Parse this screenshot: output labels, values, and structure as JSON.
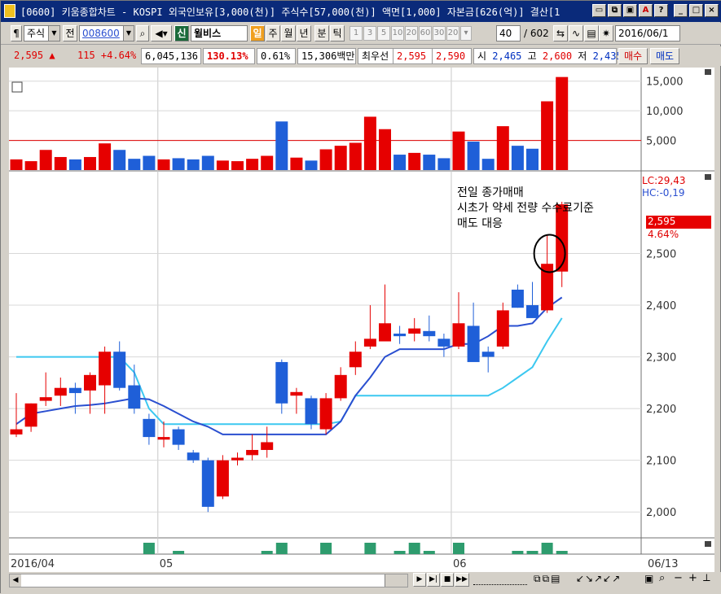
{
  "window": {
    "title": "[0600] 키움종합차트 - KOSPI 외국인보유[3,000(천)] 주식수[57,000(천)] 액면[1,000] 자본금[626(억)] 결산[1"
  },
  "toolbar": {
    "market": "주식",
    "prev_label": "전",
    "code": "008600",
    "credit_label": "신",
    "stock_name": "윌비스",
    "period_tabs": [
      "일",
      "주",
      "월",
      "년",
      "분",
      "틱"
    ],
    "minute_options": [
      "1",
      "3",
      "5",
      "10",
      "20",
      "60",
      "30",
      "20"
    ],
    "count_value": "40",
    "count_total": "/ 602",
    "date_value": "2016/06/1"
  },
  "quote": {
    "price": "2,595 ▲",
    "change": "115 +4.64%",
    "volume": "6,045,136",
    "volume_ratio": "130.13%",
    "turnover": "0.61%",
    "amount": "15,306백만",
    "best_label": "최우선",
    "ask": "2,595",
    "bid": "2,590",
    "open_label": "시",
    "open": "2,465",
    "high_label": "고",
    "high": "2,600",
    "low_label": "저",
    "low": "2,435",
    "buy_label": "매수",
    "sell_label": "매도"
  },
  "annotation": {
    "line1": "전일 종가매매",
    "line2": "시초가 약세 전량 수수료기준",
    "line3": "매도 대응"
  },
  "indicators": {
    "lc": "LC:29,43",
    "hc": "HC:-0,19",
    "current_price": "2,595",
    "current_change": "4.64%"
  },
  "x_axis": {
    "labels": [
      "2016/04",
      "05",
      "06"
    ],
    "right_label": "06/13"
  },
  "colors": {
    "up": "#e60000",
    "down": "#1f5fd8",
    "ma_dark": "#2a4fd0",
    "ma_light": "#3cc8f0",
    "volume_limit": "#e00000",
    "osc": "#2e9c6e"
  },
  "chart_data": {
    "type": "candlestick",
    "volume_axis": {
      "ticks": [
        "5,000",
        "10,000",
        "15,000"
      ],
      "ylim": [
        0,
        16200
      ],
      "reference_line": 5000
    },
    "price_axis": {
      "ticks": [
        "2,000",
        "2,100",
        "2,200",
        "2,300",
        "2,400",
        "2,500"
      ],
      "ylim": [
        1950,
        2655
      ]
    },
    "candles": [
      {
        "o": 2150,
        "h": 2230,
        "l": 2145,
        "c": 2160
      },
      {
        "o": 2165,
        "h": 2210,
        "l": 2155,
        "c": 2210
      },
      {
        "o": 2215,
        "h": 2270,
        "l": 2205,
        "c": 2222
      },
      {
        "o": 2225,
        "h": 2260,
        "l": 2205,
        "c": 2240
      },
      {
        "o": 2240,
        "h": 2250,
        "l": 2190,
        "c": 2230
      },
      {
        "o": 2235,
        "h": 2270,
        "l": 2190,
        "c": 2265
      },
      {
        "o": 2245,
        "h": 2320,
        "l": 2190,
        "c": 2310
      },
      {
        "o": 2310,
        "h": 2330,
        "l": 2235,
        "c": 2240
      },
      {
        "o": 2245,
        "h": 2285,
        "l": 2190,
        "c": 2200
      },
      {
        "o": 2180,
        "h": 2190,
        "l": 2130,
        "c": 2145
      },
      {
        "o": 2140,
        "h": 2175,
        "l": 2125,
        "c": 2145
      },
      {
        "o": 2160,
        "h": 2165,
        "l": 2120,
        "c": 2130
      },
      {
        "o": 2115,
        "h": 2120,
        "l": 2095,
        "c": 2100
      },
      {
        "o": 2100,
        "h": 2105,
        "l": 2000,
        "c": 2010
      },
      {
        "o": 2030,
        "h": 2110,
        "l": 2025,
        "c": 2100
      },
      {
        "o": 2100,
        "h": 2115,
        "l": 2090,
        "c": 2105
      },
      {
        "o": 2110,
        "h": 2150,
        "l": 2100,
        "c": 2120
      },
      {
        "o": 2120,
        "h": 2165,
        "l": 2105,
        "c": 2135
      },
      {
        "o": 2290,
        "h": 2295,
        "l": 2190,
        "c": 2210
      },
      {
        "o": 2225,
        "h": 2240,
        "l": 2190,
        "c": 2232
      },
      {
        "o": 2220,
        "h": 2225,
        "l": 2160,
        "c": 2170
      },
      {
        "o": 2160,
        "h": 2230,
        "l": 2150,
        "c": 2220
      },
      {
        "o": 2220,
        "h": 2280,
        "l": 2215,
        "c": 2265
      },
      {
        "o": 2280,
        "h": 2330,
        "l": 2265,
        "c": 2310
      },
      {
        "o": 2320,
        "h": 2400,
        "l": 2315,
        "c": 2335
      },
      {
        "o": 2330,
        "h": 2440,
        "l": 2330,
        "c": 2365
      },
      {
        "o": 2345,
        "h": 2360,
        "l": 2325,
        "c": 2340
      },
      {
        "o": 2345,
        "h": 2375,
        "l": 2330,
        "c": 2355
      },
      {
        "o": 2350,
        "h": 2380,
        "l": 2330,
        "c": 2340
      },
      {
        "o": 2335,
        "h": 2345,
        "l": 2300,
        "c": 2320
      },
      {
        "o": 2320,
        "h": 2425,
        "l": 2315,
        "c": 2365
      },
      {
        "o": 2360,
        "h": 2405,
        "l": 2325,
        "c": 2290
      },
      {
        "o": 2310,
        "h": 2320,
        "l": 2270,
        "c": 2300
      },
      {
        "o": 2320,
        "h": 2405,
        "l": 2315,
        "c": 2390
      },
      {
        "o": 2430,
        "h": 2440,
        "l": 2395,
        "c": 2395
      },
      {
        "o": 2400,
        "h": 2445,
        "l": 2385,
        "c": 2375
      },
      {
        "o": 2390,
        "h": 2535,
        "l": 2385,
        "c": 2480
      },
      {
        "o": 2465,
        "h": 2600,
        "l": 2435,
        "c": 2595
      }
    ],
    "volumes": [
      1800,
      1500,
      3400,
      2200,
      1800,
      2200,
      4500,
      3400,
      1900,
      2400,
      1800,
      2000,
      1800,
      2400,
      1600,
      1500,
      1900,
      2400,
      8200,
      2100,
      1600,
      3500,
      4100,
      4600,
      9000,
      6900,
      2600,
      2900,
      2600,
      2000,
      6500,
      4800,
      1900,
      7400,
      4100,
      3600,
      11600,
      15700
    ],
    "ma_dark": [
      2170,
      2190,
      2195,
      2200,
      2205,
      2207,
      2210,
      2215,
      2220,
      2218,
      2205,
      2190,
      2175,
      2165,
      2150,
      2150,
      2150,
      2150,
      2150,
      2150,
      2150,
      2150,
      2175,
      2225,
      2260,
      2300,
      2315,
      2315,
      2315,
      2315,
      2325,
      2325,
      2340,
      2360,
      2360,
      2365,
      2395,
      2415
    ],
    "ma_light": [
      2300,
      2300,
      2300,
      2300,
      2300,
      2300,
      2300,
      2300,
      2270,
      2200,
      2170,
      2170,
      2170,
      2170,
      2170,
      2170,
      2170,
      2170,
      2170,
      2170,
      2170,
      2170,
      2175,
      2225,
      2225,
      2225,
      2225,
      2225,
      2225,
      2225,
      2225,
      2225,
      2225,
      2240,
      2260,
      2280,
      2330,
      2375
    ]
  }
}
